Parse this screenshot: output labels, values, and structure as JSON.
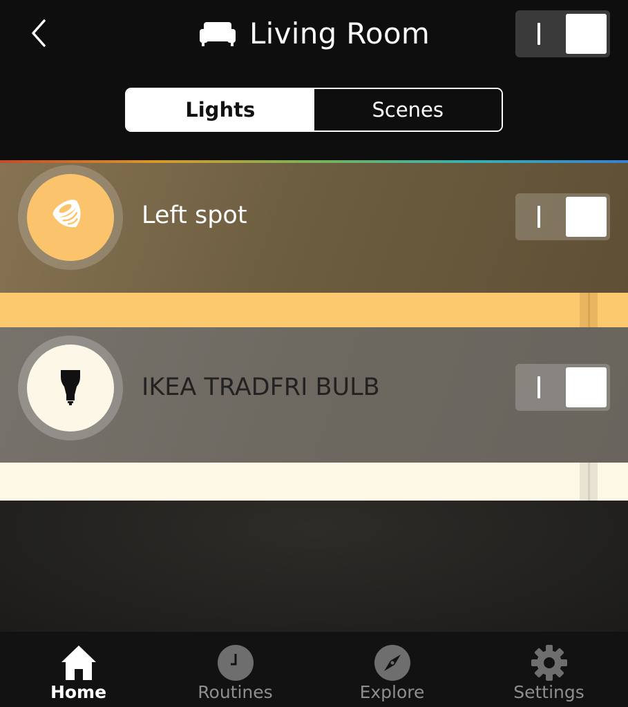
{
  "header": {
    "title": "Living Room",
    "room_icon": "sofa-icon",
    "back_icon": "chevron-left-icon",
    "master_toggle_on": true
  },
  "tabs": [
    {
      "label": "Lights",
      "active": true
    },
    {
      "label": "Scenes",
      "active": false
    }
  ],
  "lights": [
    {
      "name": "Left spot",
      "icon": "spotlight-icon",
      "on": true,
      "brightness_percent": 94,
      "color": "#fbc46c"
    },
    {
      "name": "IKEA TRADFRI BULB",
      "icon": "bulb-icon",
      "on": true,
      "brightness_percent": 94,
      "color": "#fdf7e7"
    }
  ],
  "nav": [
    {
      "label": "Home",
      "icon": "home-icon",
      "active": true
    },
    {
      "label": "Routines",
      "icon": "clock-icon",
      "active": false
    },
    {
      "label": "Explore",
      "icon": "compass-icon",
      "active": false
    },
    {
      "label": "Settings",
      "icon": "gear-icon",
      "active": false
    }
  ],
  "colors": {
    "background": "#0e0e0e",
    "accent_warm": "#fdc96f",
    "accent_white": "#fef8e6"
  }
}
